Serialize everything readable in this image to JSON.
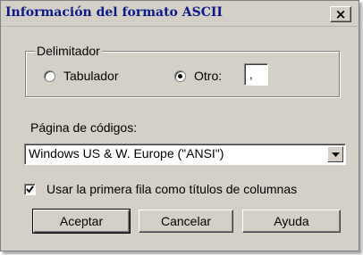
{
  "dialog": {
    "title": "Información del formato ASCII",
    "close_label": "×"
  },
  "delimiter": {
    "legend": "Delimitador",
    "options": [
      {
        "label": "Tabulador",
        "selected": false
      },
      {
        "label": "Otro:",
        "selected": true
      }
    ],
    "other_value": ","
  },
  "codepage": {
    "label": "Página de códigos:",
    "selected": "Windows US & W. Europe (\"ANSI\")"
  },
  "first_row_headers": {
    "label": "Usar la primera fila como títulos de columnas",
    "checked": true
  },
  "buttons": {
    "ok": "Aceptar",
    "cancel": "Cancelar",
    "help": "Ayuda"
  },
  "colors": {
    "dialog_bg": "#d4d0c8",
    "title_text": "#0c1a86"
  }
}
